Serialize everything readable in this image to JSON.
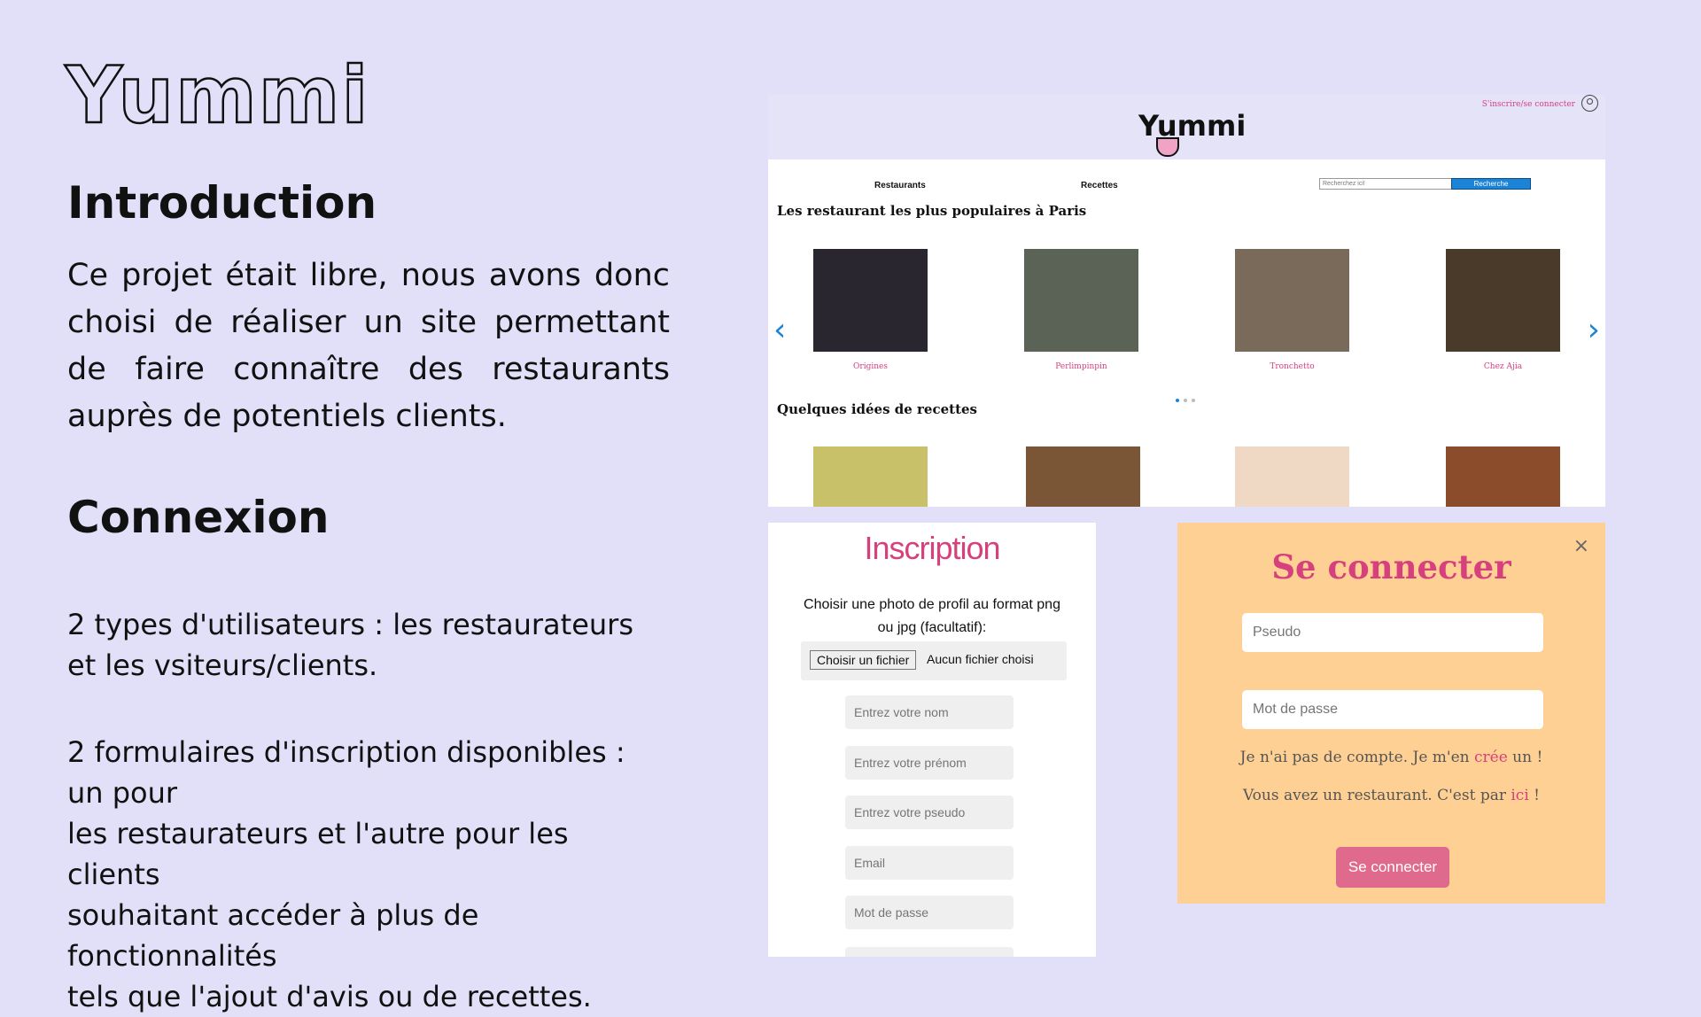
{
  "slide": {
    "brand": "Yummi",
    "intro_title": "Introduction",
    "intro_text": "Ce projet était libre, nous avons donc choisi de réaliser un site permettant de faire connaître des restaurants auprès de potentiels clients.",
    "connexion_title": "Connexion",
    "connexion_text_1a": "2 types d'utilisateurs : les restaurateurs",
    "connexion_text_1b": "et les vsiteurs/clients.",
    "connexion_text_2a": "2 formulaires d'inscription disponibles : un pour",
    "connexion_text_2b": "les restaurateurs et l'autre pour les clients",
    "connexion_text_2c": "souhaitant accéder à plus de fonctionnalités",
    "connexion_text_2d": "tels que l'ajout d'avis ou de recettes."
  },
  "site": {
    "logo": "Yummi",
    "signin_link": "S'inscrire/se connecter",
    "nav": {
      "restaurants": "Restaurants",
      "recipes": "Recettes"
    },
    "search": {
      "placeholder": "Recherchez ici!",
      "button": "Recherche"
    },
    "popular_title": "Les restaurant les plus populaires à Paris",
    "restaurants": [
      {
        "name": "Origines",
        "color": "#2a2630"
      },
      {
        "name": "Perlimpinpin",
        "color": "#5b6256"
      },
      {
        "name": "Tronchetto",
        "color": "#7a6a5a"
      },
      {
        "name": "Chez Ajia",
        "color": "#4a3a2a"
      }
    ],
    "carousel": {
      "prev": "‹",
      "next": "›",
      "pages": 3,
      "active_page": 1
    },
    "recipes_title": "Quelques idées de recettes",
    "recipe_colors": [
      "#c9c06a",
      "#7a5536",
      "#efd9c4",
      "#8a4c2a"
    ]
  },
  "inscription": {
    "title": "Inscription",
    "photo_text": "Choisir une photo de profil au format png ou jpg (facultatif):",
    "file_button": "Choisir un fichier",
    "file_status": "Aucun fichier choisi",
    "fields": {
      "nom": "Entrez votre nom",
      "prenom": "Entrez votre prénom",
      "pseudo": "Entrez votre pseudo",
      "email": "Email",
      "password": "Mot de passe"
    }
  },
  "login": {
    "close": "×",
    "title": "Se connecter",
    "pseudo": "Pseudo",
    "password": "Mot de passe",
    "no_account_pre": "Je n'ai pas de compte. Je m'en ",
    "no_account_link": "crée",
    "no_account_post": " un !",
    "restaurant_pre": "Vous avez un restaurant. C'est par ",
    "restaurant_link": "ici",
    "restaurant_post": " !",
    "button": "Se connecter"
  }
}
